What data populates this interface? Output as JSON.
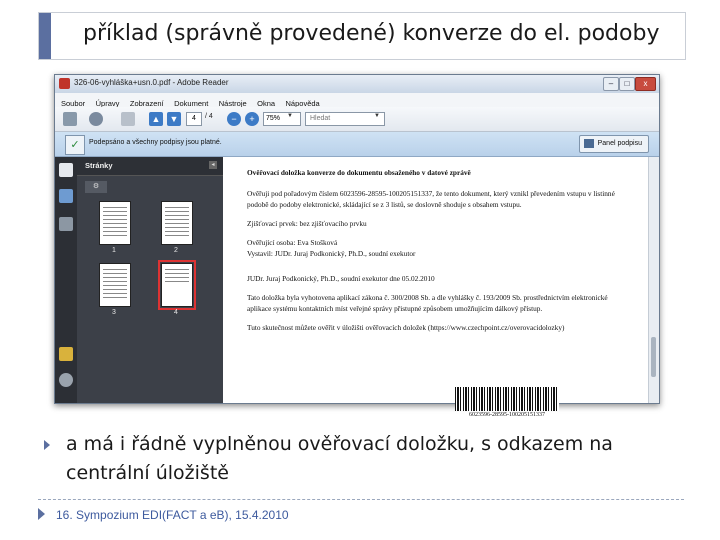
{
  "slide": {
    "title": "příklad (správně provedené) konverze do el. podoby",
    "bullet": "a má i řádně vyplněnou ověřovací doložku, s odkazem na centrální úložiště",
    "footer": "16. Sympozium EDI(FACT a eB), 15.4.2010"
  },
  "window": {
    "title": "326-06-vyhláška+usn.0.pdf - Adobe Reader",
    "buttons": {
      "minimize": "–",
      "maximize": "□",
      "close": "x"
    }
  },
  "menu": [
    "Soubor",
    "Úpravy",
    "Zobrazení",
    "Dokument",
    "Nástroje",
    "Okna",
    "Nápověda"
  ],
  "toolbar": {
    "page_current": "4",
    "page_total": "/ 4",
    "zoom": "75%",
    "search_placeholder": "Hledat"
  },
  "signature_bar": {
    "message": "Podepsáno a všechny podpisy jsou platné.",
    "panel_button": "Panel podpisu"
  },
  "side_panel": {
    "title": "Stránky",
    "thumbnails": [
      {
        "label": "1",
        "selected": false
      },
      {
        "label": "2",
        "selected": false
      },
      {
        "label": "3",
        "selected": false
      },
      {
        "label": "4",
        "selected": true
      }
    ]
  },
  "document": {
    "heading": "Ověřovací doložka konverze do dokumentu obsaženého v datové zprávě",
    "para1": "Ověřuji pod pořadovým číslem 6023596-28595-100205151337, že tento dokument, který vznikl převedením vstupu v listinné podobě do podoby elektronické, skládající se z 3 listů, se doslovně shoduje s obsahem vstupu.",
    "para2": "Zjišťovací prvek: bez zjišťovacího prvku",
    "para3a": "Ověřující osoba: Eva Stošková",
    "para3b": "Vystavil: JUDr. Juraj Podkonický, Ph.D., soudní exekutor",
    "para4": "JUDr. Juraj Podkonický, Ph.D., soudní exekutor dne 05.02.2010",
    "para5": "Tato doložka byla vyhotovena aplikací zákona č. 300/2008 Sb. a dle vyhlášky č. 193/2009 Sb. prostřednictvím elektronické aplikace systému kontaktních míst veřejné správy přistupné způsobem umožňujícím dálkový přístup.",
    "para6": "Tuto skutečnost můžete ověřit v úložišti ověřovacích doložek (https://www.czechpoint.cz/overovacidolozky)",
    "barcode_number": "6023596-28595-100205151337"
  }
}
